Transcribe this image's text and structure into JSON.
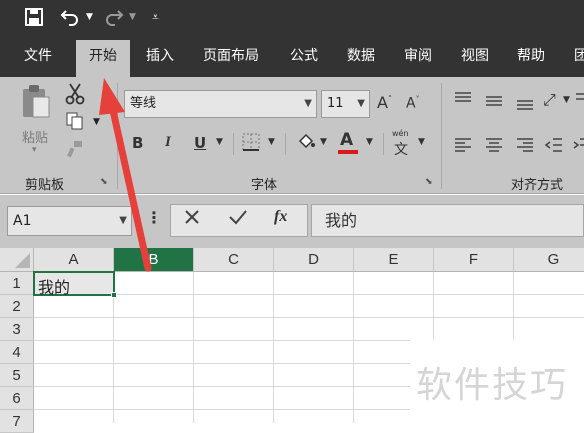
{
  "quick_access": {
    "save_icon": "save-icon",
    "undo_icon": "undo-icon",
    "redo_icon": "redo-icon",
    "customize_icon": "customize-icon"
  },
  "tabs": [
    {
      "label": "文件"
    },
    {
      "label": "开始",
      "active": true
    },
    {
      "label": "插入"
    },
    {
      "label": "页面布局"
    },
    {
      "label": "公式"
    },
    {
      "label": "数据"
    },
    {
      "label": "审阅"
    },
    {
      "label": "视图"
    },
    {
      "label": "帮助"
    },
    {
      "label": "团"
    }
  ],
  "ribbon": {
    "clipboard": {
      "paste_label": "粘贴",
      "group_label": "剪贴板"
    },
    "font": {
      "font_name": "等线",
      "font_size": "11",
      "wen_label": "wén",
      "wen_char": "文",
      "group_label": "字体",
      "bold": "B",
      "italic": "I",
      "underline": "U",
      "font_color": "#d9191c"
    },
    "alignment": {
      "group_label": "对齐方式"
    }
  },
  "formula_bar": {
    "name_box": "A1",
    "fx_label": "fx",
    "content": "我的"
  },
  "sheet": {
    "columns": [
      "A",
      "B",
      "C",
      "D",
      "E",
      "F",
      "G"
    ],
    "rows": [
      "1",
      "2",
      "3",
      "4",
      "5",
      "6",
      "7"
    ],
    "cells": {
      "A1": "我的"
    },
    "selected_column": "B",
    "accent": "#217346"
  },
  "watermark": "软件技巧",
  "annotation_color": "#e5413a"
}
